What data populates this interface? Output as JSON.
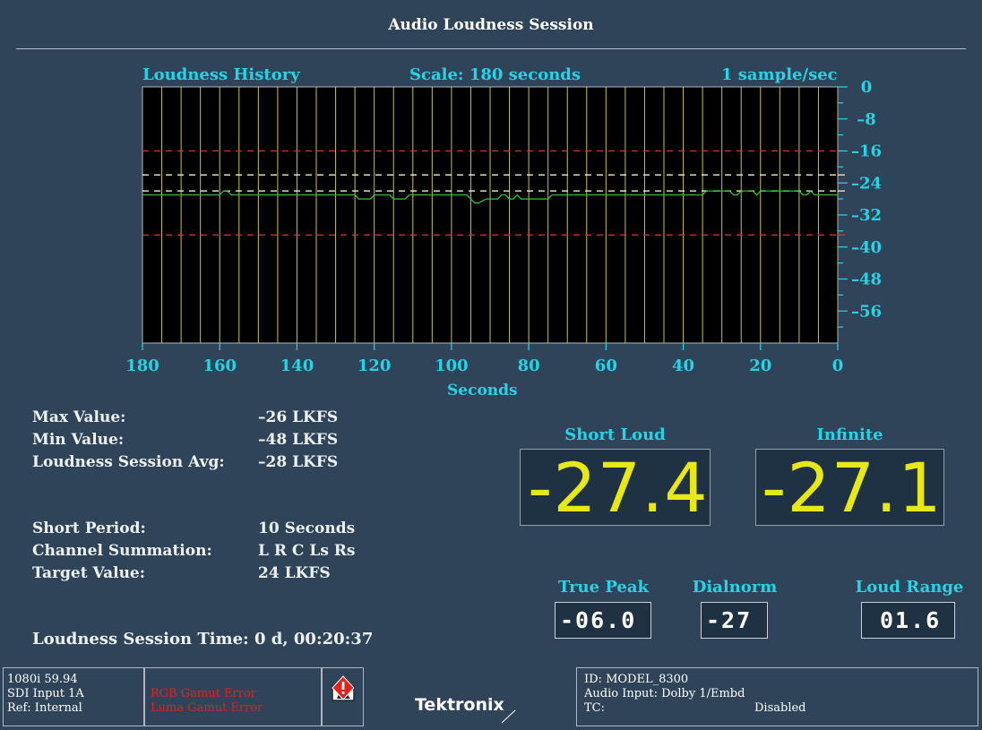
{
  "title": "Audio Loudness Session",
  "history": {
    "label": "Loudness History",
    "scale": "Scale: 180 seconds",
    "rate": "1 sample/sec"
  },
  "chart_data": {
    "type": "line",
    "title": "Loudness History",
    "xlabel": "Seconds",
    "ylabel": "",
    "xlim": [
      180,
      0
    ],
    "ylim": [
      -64,
      0
    ],
    "x_ticks": [
      "180",
      "160",
      "140",
      "120",
      "100",
      "80",
      "60",
      "40",
      "20",
      "0"
    ],
    "y_ticks": [
      "0",
      "-8",
      "-16",
      "-24",
      "-32",
      "-40",
      "-48",
      "-56"
    ],
    "reference_lines": [
      {
        "value": -16,
        "color": "#d8352a"
      },
      {
        "value": -22,
        "color": "#f2eec4"
      },
      {
        "value": -26,
        "color": "#f2eec4"
      },
      {
        "value": -37,
        "color": "#d8352a"
      }
    ],
    "series": [
      {
        "color": "#36c83c",
        "x": [
          180,
          160,
          159,
          158,
          157,
          156,
          125,
          124,
          121,
          120,
          119,
          116,
          115,
          112,
          111,
          96,
          95,
          94,
          93,
          91,
          88,
          87,
          86,
          85,
          84,
          83,
          82,
          75,
          74,
          73,
          72,
          35,
          34,
          28,
          27,
          26,
          25,
          22,
          21,
          20,
          10,
          9,
          8,
          7,
          6,
          5,
          0
        ],
        "y": [
          -27,
          -27,
          -26,
          -26,
          -27,
          -27,
          -27,
          -28,
          -28,
          -27,
          -27,
          -27,
          -28,
          -28,
          -27,
          -27,
          -28,
          -29,
          -29,
          -28,
          -28,
          -27,
          -27,
          -28,
          -28,
          -27,
          -28,
          -28,
          -27,
          -27,
          -27,
          -27,
          -26,
          -26,
          -27,
          -27,
          -26,
          -26,
          -27,
          -26,
          -26,
          -27,
          -27,
          -26,
          -27,
          -27,
          -27
        ]
      }
    ],
    "grid": true
  },
  "stats": {
    "max_label": "Max Value:",
    "max_value": "–26 LKFS",
    "min_label": "Min Value:",
    "min_value": "–48 LKFS",
    "avg_label": "Loudness Session Avg:",
    "avg_value": "–28 LKFS",
    "short_period_label": "Short Period:",
    "short_period_value": "10 Seconds",
    "channel_sum_label": "Channel Summation:",
    "channel_sum_value": "L R C Ls Rs",
    "target_label": "Target Value:",
    "target_value": "24 LKFS",
    "session_time_label": "Loudness Session Time:",
    "session_time_value": "0 d, 00:20:37"
  },
  "meters": {
    "short_loud_label": "Short Loud",
    "short_loud_value": "-27.4",
    "infinite_label": "Infinite",
    "infinite_value": "-27.1",
    "true_peak_label": "True Peak",
    "true_peak_value": "-06.0",
    "dialnorm_label": "Dialnorm",
    "dialnorm_value": "-27",
    "loud_range_label": "Loud Range",
    "loud_range_value": "01.6"
  },
  "status": {
    "format": "1080i 59.94",
    "input": "SDI Input 1A",
    "ref": "Ref: Internal",
    "error1": "RGB Gamut Error",
    "error2": "Luma Gamut Error",
    "alarm_icon": "alarm-warning-icon",
    "brand": "Tektronix",
    "id": "ID: MODEL_8300",
    "audio_input": "Audio Input: Dolby 1/Embd",
    "tc_label": "TC:",
    "tc_value": "Disabled"
  },
  "colors": {
    "accent": "#27d3e6",
    "meter_text": "#e8e817",
    "trace": "#36c83c",
    "gridline": "#c9c24a",
    "error": "#e0231e"
  }
}
